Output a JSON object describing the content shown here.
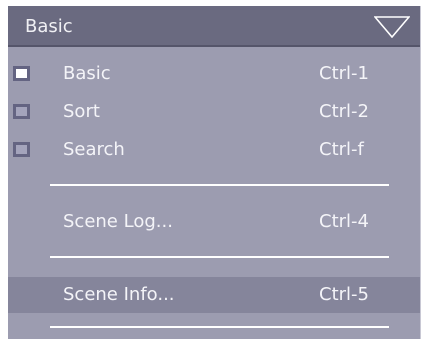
{
  "header": {
    "title": "Basic",
    "icon": "triangle-down-icon"
  },
  "items": [
    {
      "label": "Basic",
      "shortcut": "Ctrl-1",
      "icon": "window-icon",
      "active": true
    },
    {
      "label": "Sort",
      "shortcut": "Ctrl-2",
      "icon": "window-icon",
      "active": false
    },
    {
      "label": "Search",
      "shortcut": "Ctrl-f",
      "icon": "window-icon",
      "active": false
    },
    {
      "label": "Scene Log...",
      "shortcut": "Ctrl-4"
    },
    {
      "label": "Scene Info...",
      "shortcut": "Ctrl-5",
      "highlighted": true
    }
  ],
  "colors": {
    "menu_background": "#9c9cb0",
    "header_background": "#6a6a80",
    "highlight_background": "#85859b",
    "text": "#f4f4f8"
  }
}
